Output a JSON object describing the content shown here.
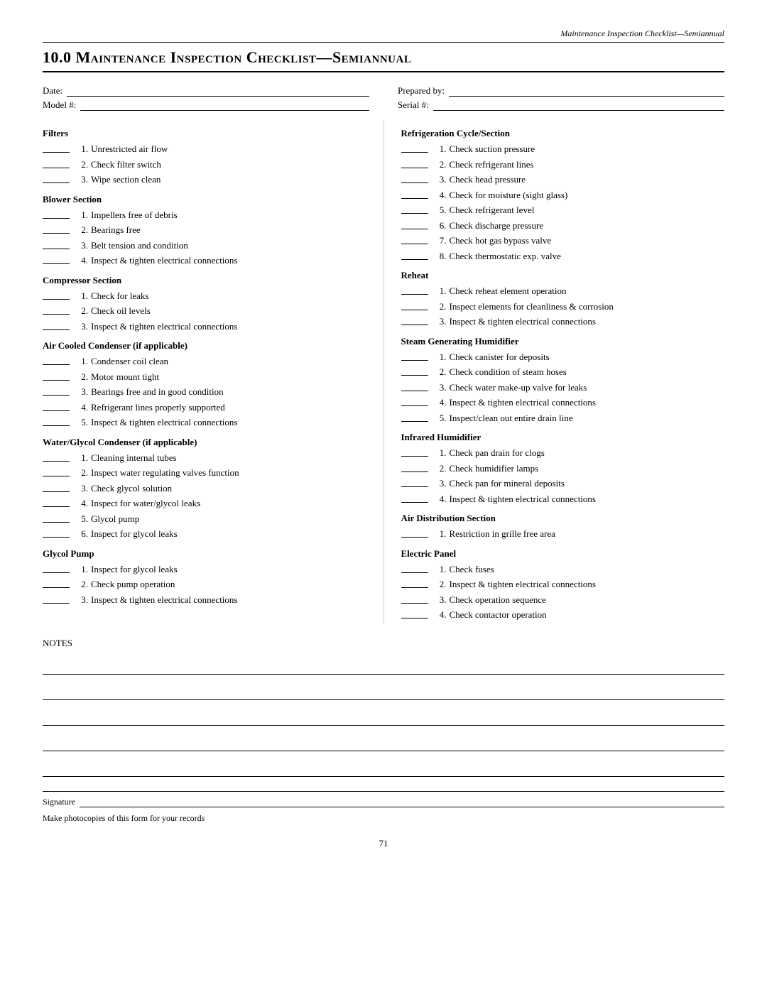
{
  "header": {
    "page_header": "Maintenance Inspection Checklist—Semiannual"
  },
  "title": {
    "number": "10.0",
    "text": "Maintenance Inspection Checklist—Semiannual"
  },
  "meta": {
    "date_label": "Date:",
    "model_label": "Model #:",
    "prepared_label": "Prepared by:",
    "serial_label": "Serial #:"
  },
  "left_column": {
    "sections": [
      {
        "title": "Filters",
        "items": [
          "Unrestricted air flow",
          "Check filter switch",
          "Wipe section clean"
        ]
      },
      {
        "title": "Blower Section",
        "items": [
          "Impellers free of debris",
          "Bearings free",
          "Belt tension and condition",
          "Inspect & tighten electrical connections"
        ]
      },
      {
        "title": "Compressor Section",
        "items": [
          "Check for leaks",
          "Check oil levels",
          "Inspect & tighten electrical connections"
        ]
      },
      {
        "title": "Air Cooled Condenser (if applicable)",
        "items": [
          "Condenser coil clean",
          "Motor mount tight",
          "Bearings free and in good condition",
          "Refrigerant lines properly supported",
          "Inspect & tighten electrical connections"
        ]
      },
      {
        "title": "Water/Glycol Condenser (if applicable)",
        "items": [
          "Cleaning internal tubes",
          "Inspect water regulating valves function",
          "Check glycol solution",
          "Inspect for water/glycol leaks",
          "Glycol pump",
          "Inspect for glycol leaks"
        ]
      },
      {
        "title": "Glycol Pump",
        "items": [
          "Inspect for glycol leaks",
          "Check pump operation",
          "Inspect & tighten electrical connections"
        ]
      }
    ]
  },
  "right_column": {
    "sections": [
      {
        "title": "Refrigeration Cycle/Section",
        "items": [
          "Check suction pressure",
          "Check refrigerant lines",
          "Check head pressure",
          "Check for moisture (sight glass)",
          "Check refrigerant level",
          "Check discharge pressure",
          "Check hot gas bypass valve",
          "Check thermostatic exp. valve"
        ]
      },
      {
        "title": "Reheat",
        "items": [
          "Check reheat element operation",
          "Inspect elements for cleanliness & corrosion",
          "Inspect & tighten electrical connections"
        ]
      },
      {
        "title": "Steam Generating Humidifier",
        "items": [
          "Check canister for deposits",
          "Check condition of steam hoses",
          "Check water make-up valve for leaks",
          "Inspect & tighten electrical connections",
          "Inspect/clean out entire drain line"
        ]
      },
      {
        "title": "Infrared Humidifier",
        "items": [
          "Check pan drain for clogs",
          "Check humidifier lamps",
          "Check pan for mineral deposits",
          "Inspect & tighten electrical connections"
        ]
      },
      {
        "title": "Air Distribution Section",
        "items": [
          "Restriction in grille free area"
        ]
      },
      {
        "title": "Electric Panel",
        "items": [
          "Check fuses",
          "Inspect & tighten electrical connections",
          "Check operation sequence",
          "Check contactor operation"
        ]
      }
    ]
  },
  "notes": {
    "label": "NOTES",
    "lines": 5
  },
  "bottom": {
    "signature_label": "Signature",
    "photocopies_note": "Make photocopies of this form for your records"
  },
  "page_number": "71"
}
